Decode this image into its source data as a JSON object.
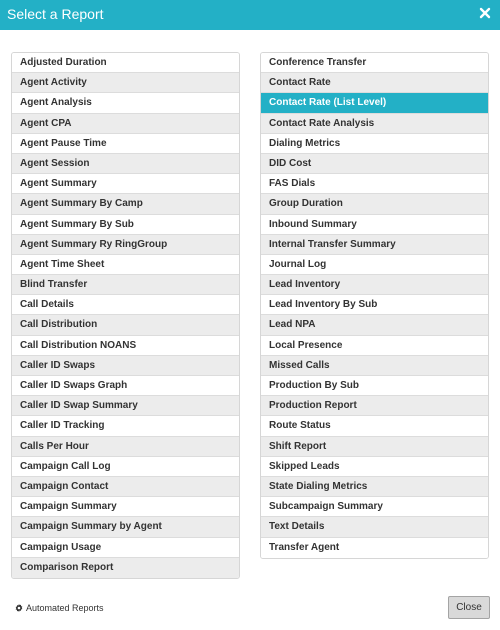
{
  "modal": {
    "title": "Select a Report",
    "close_icon": "close-icon"
  },
  "left_reports": [
    "Adjusted Duration",
    "Agent Activity",
    "Agent Analysis",
    "Agent CPA",
    "Agent Pause Time",
    "Agent Session",
    "Agent Summary",
    "Agent Summary By Camp",
    "Agent Summary By Sub",
    "Agent Summary Ry RingGroup",
    "Agent Time Sheet",
    "Blind Transfer",
    "Call Details",
    "Call Distribution",
    "Call Distribution NOANS",
    "Caller ID Swaps",
    "Caller ID Swaps Graph",
    "Caller ID Swap Summary",
    "Caller ID Tracking",
    "Calls Per Hour",
    "Campaign Call Log",
    "Campaign Contact",
    "Campaign Summary",
    "Campaign Summary by Agent",
    "Campaign Usage",
    "Comparison Report"
  ],
  "right_reports": [
    "Conference Transfer",
    "Contact Rate",
    "Contact Rate (List Level)",
    "Contact Rate Analysis",
    "Dialing Metrics",
    "DID Cost",
    "FAS Dials",
    "Group Duration",
    "Inbound Summary",
    "Internal Transfer Summary",
    "Journal Log",
    "Lead Inventory",
    "Lead Inventory By Sub",
    "Lead NPA",
    "Local Presence",
    "Missed Calls",
    "Production By Sub",
    "Production Report",
    "Route Status",
    "Shift Report",
    "Skipped Leads",
    "State Dialing Metrics",
    "Subcampaign Summary",
    "Text Details",
    "Transfer Agent"
  ],
  "selected_report": "Contact Rate (List Level)",
  "footer": {
    "automated_reports_label": "Automated Reports",
    "automated_reports_icon": "gear-icon",
    "close_label": "Close"
  },
  "colors": {
    "header_bg": "#23b0c6",
    "selected_bg": "#23b0c6",
    "alt_row_bg": "#ececec",
    "close_button_bg": "#d9d9d9"
  }
}
